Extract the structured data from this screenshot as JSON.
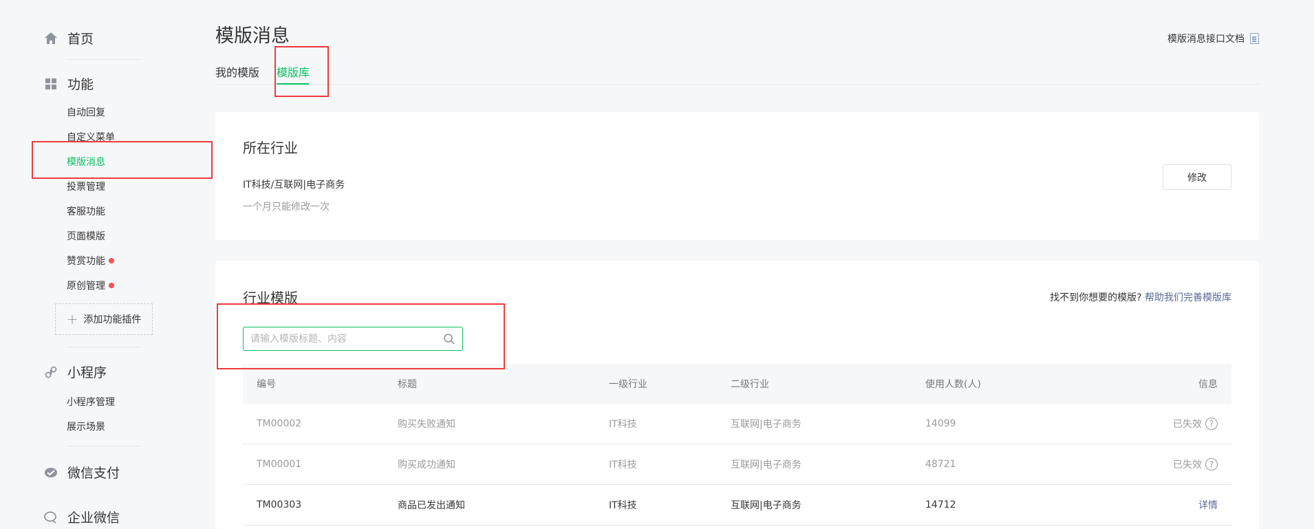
{
  "sidebar": {
    "home": "首页",
    "features": "功能",
    "features_items": [
      {
        "label": "自动回复"
      },
      {
        "label": "自定义菜单"
      },
      {
        "label": "模版消息"
      },
      {
        "label": "投票管理"
      },
      {
        "label": "客服功能"
      },
      {
        "label": "页面模版"
      },
      {
        "label": "赞赏功能"
      },
      {
        "label": "原创管理"
      }
    ],
    "add_plugin": "添加功能插件",
    "miniprogram": "小程序",
    "miniprogram_items": [
      {
        "label": "小程序管理"
      },
      {
        "label": "展示场景"
      }
    ],
    "wechat_pay": "微信支付",
    "enterprise_wechat": "企业微信"
  },
  "header": {
    "title": "模版消息",
    "doc_link": "模版消息接口文档",
    "tabs": [
      {
        "label": "我的模版"
      },
      {
        "label": "模版库"
      }
    ]
  },
  "industry_card": {
    "title": "所在行业",
    "value": "IT科技/互联网|电子商务",
    "note": "一个月只能修改一次",
    "modify_button": "修改"
  },
  "templates_card": {
    "title": "行业模版",
    "help_text": "找不到你想要的模版?",
    "help_link": "帮助我们完善模版库",
    "search_placeholder": "请输入模版标题、内容",
    "columns": [
      "编号",
      "标题",
      "一级行业",
      "二级行业",
      "使用人数(人)",
      "信息"
    ],
    "rows": [
      {
        "id": "TM00002",
        "title": "购买失败通知",
        "industry1": "IT科技",
        "industry2": "互联网|电子商务",
        "users": "14099",
        "info": "已失效"
      },
      {
        "id": "TM00001",
        "title": "购买成功通知",
        "industry1": "IT科技",
        "industry2": "互联网|电子商务",
        "users": "48721",
        "info": "已失效"
      },
      {
        "id": "TM00303",
        "title": "商品已发出通知",
        "industry1": "IT科技",
        "industry2": "互联网|电子商务",
        "users": "14712",
        "info": "详情"
      }
    ]
  },
  "colors": {
    "accent": "#07c160",
    "link": "#576b95",
    "highlight_box": "#f0393c",
    "badge_dot": "#fa5151"
  }
}
